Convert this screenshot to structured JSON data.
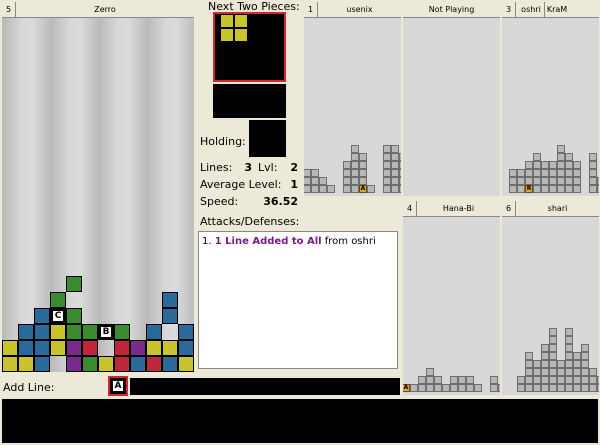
{
  "main_board": {
    "number": "5",
    "player": "Zerro"
  },
  "sidebar": {
    "next_label": "Next Two Pieces:",
    "holding_label": "Holding:",
    "lines_label": "Lines:",
    "lines_value": "3",
    "lvl_label": "Lvl:",
    "lvl_value": "2",
    "avg_label": "Average Level:",
    "avg_value": "1",
    "speed_label": "Speed:",
    "speed_value": "36.52",
    "attacks_label": "Attacks/Defenses:",
    "attack_log": [
      {
        "prefix": "1. ",
        "highlight": "1 Line Added to All",
        "suffix": " from oshri"
      }
    ]
  },
  "opponents": [
    {
      "number": "1",
      "name": "usenix",
      "special": "A"
    },
    {
      "number": "",
      "name": "Not Playing",
      "special": ""
    },
    {
      "number": "3",
      "name": "oshri",
      "name2": "KraM",
      "special": "R"
    },
    {
      "number": "4",
      "name": "Hana-Bi",
      "special": "A"
    },
    {
      "number": "6",
      "name": "shari",
      "special": ""
    }
  ],
  "add_line": {
    "label": "Add Line:",
    "special": "A"
  },
  "colors": {
    "blue": "#2a6a9a",
    "yellow": "#c9c32e",
    "green": "#3b8a2e",
    "red": "#c0263a",
    "purple": "#7a2a8c",
    "next": "#c9c32e"
  }
}
